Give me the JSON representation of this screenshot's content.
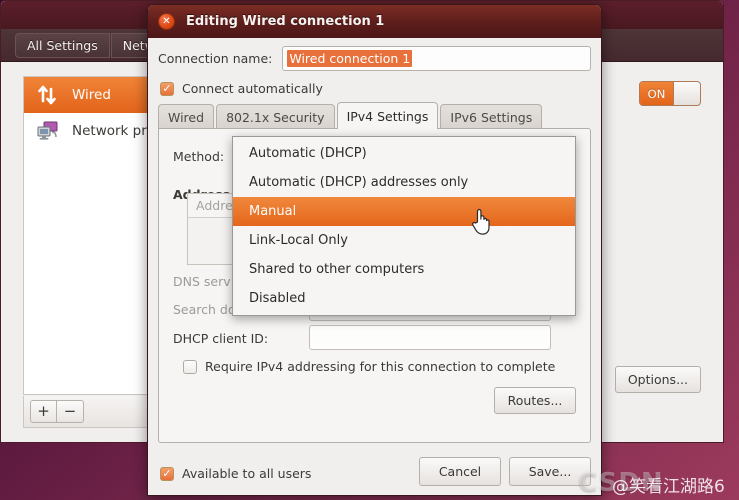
{
  "background_window": {
    "toolbar": {
      "all_settings_label": "All Settings",
      "network_label": "Netw"
    },
    "device_list": [
      {
        "label": "Wired",
        "icon": "wired-arrows-icon",
        "selected": true
      },
      {
        "label": "Network pro",
        "icon": "network-proxy-icon",
        "selected": false
      }
    ],
    "list_toolbar": {
      "add_label": "+",
      "remove_label": "−"
    },
    "toggle": {
      "state_label": "ON"
    },
    "options_button_label": "Options..."
  },
  "dialog": {
    "title": "Editing Wired connection 1",
    "close_icon": "close-icon",
    "connection_name": {
      "label": "Connection name:",
      "value": "Wired connection 1",
      "selected": true
    },
    "connect_automatically": {
      "label": "Connect automatically",
      "checked": true
    },
    "tabs": [
      {
        "label": "Wired",
        "active": false
      },
      {
        "label": "802.1x Security",
        "active": false
      },
      {
        "label": "IPv4 Settings",
        "active": true
      },
      {
        "label": "IPv6 Settings",
        "active": false
      }
    ],
    "ipv4": {
      "method_label": "Method:",
      "method_value": "Automatic (DHCP)",
      "addresses_label": "Addresses",
      "address_column_header": "Address",
      "dns_servers_label": "DNS serv",
      "search_domains_label": "Search domains:",
      "dhcp_client_id_label": "DHCP client ID:",
      "dhcp_client_id_value": "",
      "require_ipv4_label": "Require IPv4 addressing for this connection to complete",
      "require_ipv4_checked": false,
      "routes_button_label": "Routes..."
    },
    "method_dropdown": {
      "open": true,
      "options": [
        {
          "label": "Automatic (DHCP)",
          "highlighted": false
        },
        {
          "label": "Automatic (DHCP) addresses only",
          "highlighted": false
        },
        {
          "label": "Manual",
          "highlighted": true
        },
        {
          "label": "Link-Local Only",
          "highlighted": false
        },
        {
          "label": "Shared to other computers",
          "highlighted": false
        },
        {
          "label": "Disabled",
          "highlighted": false
        }
      ]
    },
    "footer": {
      "available_to_all_users_label": "Available to all users",
      "available_to_all_users_checked": true,
      "cancel_label": "Cancel",
      "save_label": "Save..."
    }
  },
  "watermark": {
    "site": "CSDN",
    "user": "@笑看江湖路6"
  },
  "colors": {
    "accent_orange": "#e2641b",
    "titlebar_red": "#5c1d1b",
    "desktop_purple": "#57173c"
  }
}
